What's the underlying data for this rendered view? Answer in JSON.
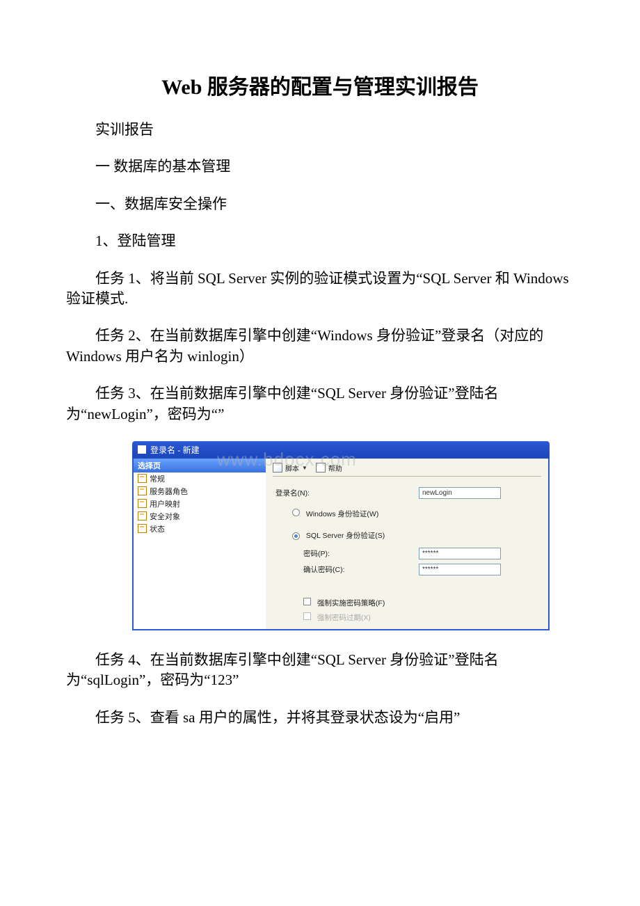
{
  "title": "Web 服务器的配置与管理实训报告",
  "paras": {
    "p1": "实训报告",
    "p2": "一 数据库的基本管理",
    "p3": "一、数据库安全操作",
    "p4": "1、登陆管理",
    "p5": "任务 1、将当前 SQL Server 实例的验证模式设置为“SQL Server 和 Windows 验证模式.",
    "p6": "任务 2、在当前数据库引擎中创建“Windows 身份验证”登录名（对应的 Windows 用户名为 winlogin）",
    "p7": "任务 3、在当前数据库引擎中创建“SQL Server 身份验证”登陆名为“newLogin”，密码为“”",
    "p8": "任务 4、在当前数据库引擎中创建“SQL Server 身份验证”登陆名为“sqlLogin”，密码为“123”",
    "p9": "任务 5、查看 sa 用户的属性，并将其登录状态设为“启用”"
  },
  "watermark": "www.bdocx.com",
  "dialog": {
    "window_title": "登录名 - 新建",
    "left_header": "选择页",
    "tree": [
      "常规",
      "服务器角色",
      "用户映射",
      "安全对象",
      "状态"
    ],
    "toolbar": {
      "script": "脚本",
      "help": "帮助"
    },
    "login_name_label": "登录名(N):",
    "login_name_value": "newLogin",
    "radio_win": "Windows 身份验证(W)",
    "radio_sql": "SQL Server 身份验证(S)",
    "pwd_label": "密码(P):",
    "pwd_value": "******",
    "pwd_confirm_label": "确认密码(C):",
    "pwd_confirm_value": "******",
    "chk_policy": "强制实施密码策略(F)",
    "chk_expire": "强制密码过期(X)"
  }
}
